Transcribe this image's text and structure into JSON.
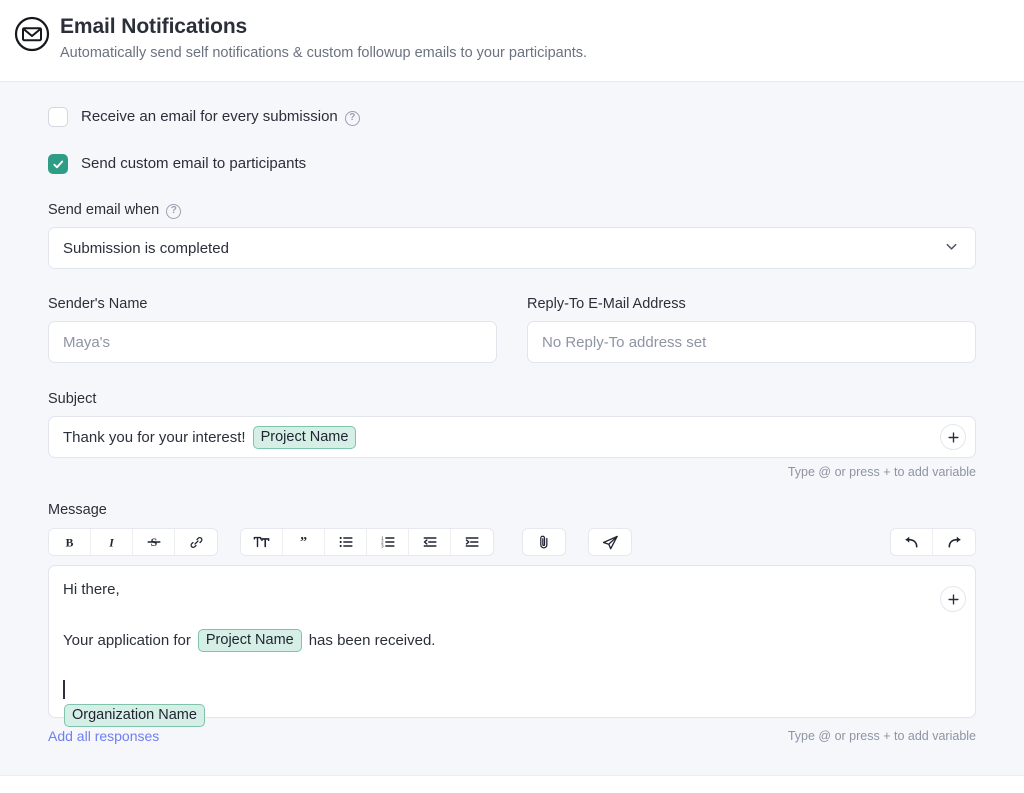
{
  "header": {
    "icon": "envelope-circle-icon",
    "title": "Email Notifications",
    "subtitle": "Automatically send self notifications & custom followup emails to your participants."
  },
  "checkboxes": [
    {
      "label": "Receive an email for every submission",
      "checked": false,
      "help": "?"
    },
    {
      "label": "Send custom email to participants",
      "checked": true
    }
  ],
  "send_when": {
    "label": "Send email when",
    "help": "?",
    "value": "Submission is completed",
    "chevron": "chevron-down-icon"
  },
  "sender": {
    "label": "Sender's Name",
    "placeholder": "Maya's"
  },
  "reply_to": {
    "label": "Reply-To E-Mail Address",
    "placeholder": "No Reply-To address set"
  },
  "subject": {
    "label": "Subject",
    "text": "Thank you for your interest!",
    "variable": "Project Name",
    "add_variable_icon": "plus-icon",
    "hint": "Type @ or press + to add variable"
  },
  "message": {
    "label": "Message",
    "toolbar": {
      "group1": [
        {
          "name": "bold-icon",
          "label": "B"
        },
        {
          "name": "italic-icon",
          "label": "I"
        },
        {
          "name": "strikethrough-icon",
          "label": "S"
        },
        {
          "name": "link-icon",
          "label": "link"
        }
      ],
      "group2": [
        {
          "name": "text-size-icon",
          "label": "TT"
        },
        {
          "name": "blockquote-icon",
          "label": "”"
        },
        {
          "name": "bullet-list-icon",
          "label": "bullets"
        },
        {
          "name": "numbered-list-icon",
          "label": "numbers"
        },
        {
          "name": "outdent-icon",
          "label": "outdent"
        },
        {
          "name": "indent-icon",
          "label": "indent"
        }
      ],
      "group3": [
        {
          "name": "attachment-icon",
          "label": "paperclip"
        }
      ],
      "group4": [
        {
          "name": "send-icon",
          "label": "paper-plane"
        }
      ],
      "group5": [
        {
          "name": "undo-icon",
          "label": "undo"
        },
        {
          "name": "redo-icon",
          "label": "redo"
        }
      ]
    },
    "body": {
      "line1": "Hi there,",
      "line2_before": "Your application for",
      "line2_variable": "Project Name",
      "line2_after": "has been received.",
      "line4_variable": "Organization Name"
    },
    "add_variable_icon": "plus-icon",
    "add_all_responses": "Add all responses",
    "hint": "Type @ or press + to add variable"
  },
  "colors": {
    "accent_teal": "#2f9d85",
    "chip_bg": "#d6efe6",
    "chip_border": "#7fc3ad",
    "link_blue": "#6e7ff3",
    "page_bg": "#f6f7fb",
    "text": "#2b2f3a",
    "muted": "#8d94a3"
  }
}
